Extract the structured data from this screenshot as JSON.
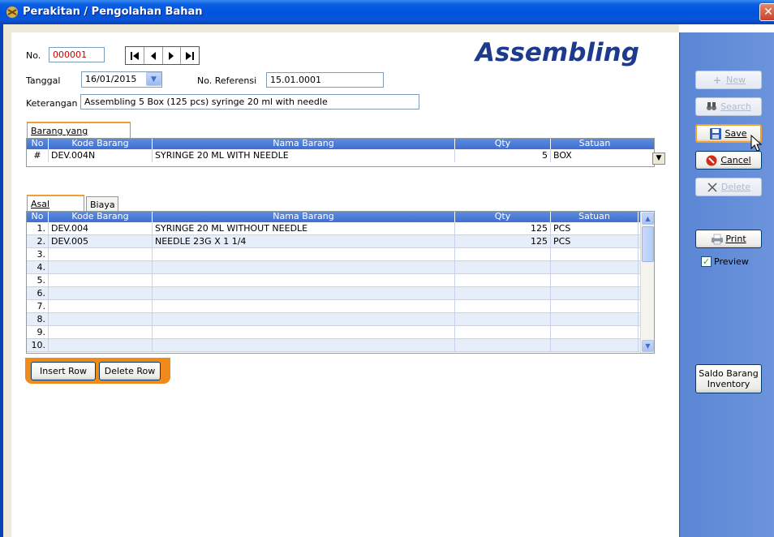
{
  "window": {
    "title": "Perakitan / Pengolahan Bahan",
    "close": "✕"
  },
  "heading": "Assembling",
  "form": {
    "no_label": "No.",
    "no_value": "000001",
    "tanggal_label": "Tanggal",
    "tanggal_value": "16/01/2015",
    "noref_label": "No. Referensi",
    "noref_value": "15.01.0001",
    "keterangan_label": "Keterangan",
    "keterangan_value": "Assembling 5 Box (125 pcs) syringe 20 ml with needle"
  },
  "nav": {
    "first": "⏮",
    "prev": "◀",
    "next": "▶",
    "last": "⏭"
  },
  "tabs_top": [
    {
      "label": "Barang yang dihasilkan"
    }
  ],
  "tabs_bottom": [
    {
      "label": "Asal Barang"
    },
    {
      "label": "Biaya"
    }
  ],
  "columns": [
    "No",
    "Kode Barang",
    "Nama Barang",
    "Qty",
    "Satuan"
  ],
  "result_rows": [
    {
      "no": "#",
      "kode": "DEV.004N",
      "nama": "SYRINGE 20 ML WITH NEEDLE",
      "qty": "5",
      "satuan": "BOX"
    }
  ],
  "source_rows": [
    {
      "no": "1.",
      "kode": "DEV.004",
      "nama": "SYRINGE 20 ML WITHOUT NEEDLE",
      "qty": "125",
      "satuan": "PCS"
    },
    {
      "no": "2.",
      "kode": "DEV.005",
      "nama": "NEEDLE 23G X 1 1/4",
      "qty": "125",
      "satuan": "PCS"
    },
    {
      "no": "3.",
      "kode": "",
      "nama": "",
      "qty": "",
      "satuan": ""
    },
    {
      "no": "4.",
      "kode": "",
      "nama": "",
      "qty": "",
      "satuan": ""
    },
    {
      "no": "5.",
      "kode": "",
      "nama": "",
      "qty": "",
      "satuan": ""
    },
    {
      "no": "6.",
      "kode": "",
      "nama": "",
      "qty": "",
      "satuan": ""
    },
    {
      "no": "7.",
      "kode": "",
      "nama": "",
      "qty": "",
      "satuan": ""
    },
    {
      "no": "8.",
      "kode": "",
      "nama": "",
      "qty": "",
      "satuan": ""
    },
    {
      "no": "9.",
      "kode": "",
      "nama": "",
      "qty": "",
      "satuan": ""
    },
    {
      "no": "10.",
      "kode": "",
      "nama": "",
      "qty": "",
      "satuan": ""
    }
  ],
  "buttons": {
    "insert_row": "Insert Row",
    "delete_row": "Delete Row",
    "new": "New",
    "search": "Search",
    "save": "Save",
    "cancel": "Cancel",
    "delete": "Delete",
    "print": "Print",
    "preview": "Preview",
    "saldo_line1": "Saldo Barang",
    "saldo_line2": "Inventory"
  },
  "colors": {
    "heading": "#1e3a8c",
    "number_red": "#cc0000",
    "grid_header": "#4a7ad8",
    "right_panel": "#6a92da",
    "orange": "#f08a1c"
  }
}
